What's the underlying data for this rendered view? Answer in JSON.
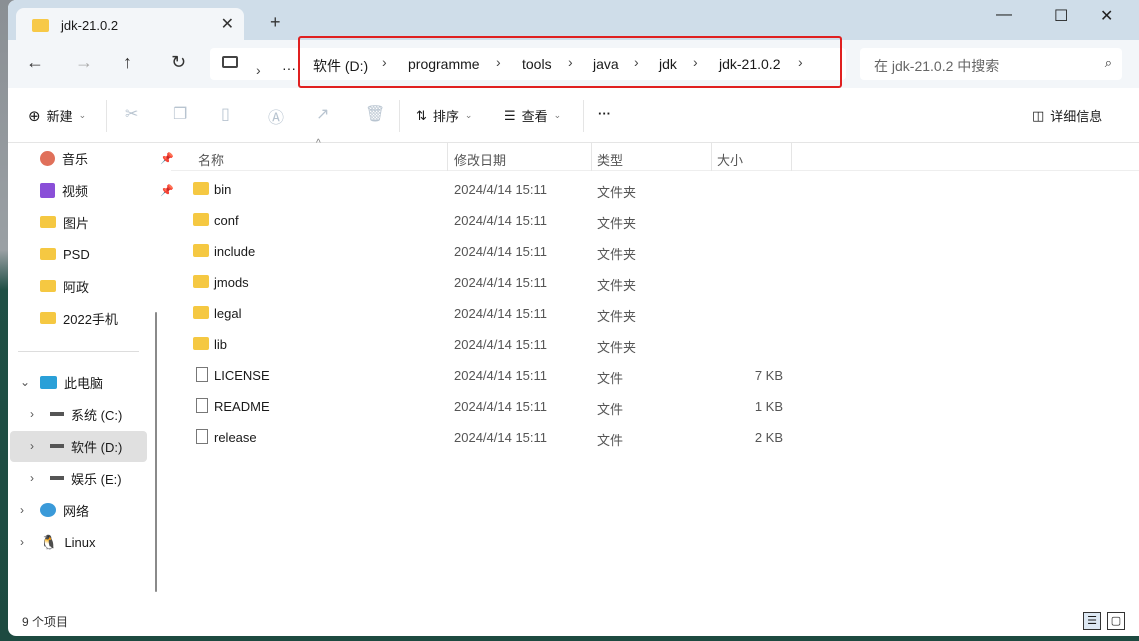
{
  "window": {
    "tab_title": "jdk-21.0.2",
    "new_tab": "+",
    "close_tab": "✕",
    "minimize": "—",
    "maximize": "☐",
    "close": "✕"
  },
  "nav": {
    "back": "←",
    "forward": "→",
    "up": "↑",
    "refresh": "↻",
    "more": "···",
    "breadcrumbs": [
      "软件 (D:)",
      "programme",
      "tools",
      "java",
      "jdk",
      "jdk-21.0.2"
    ],
    "search_placeholder": "在 jdk-21.0.2 中搜索"
  },
  "toolbar": {
    "new": "新建",
    "sort": "排序",
    "view": "查看",
    "more": "···",
    "details": "详细信息"
  },
  "sidebar": {
    "pinned": [
      {
        "label": "音乐",
        "icon": "music-icon"
      },
      {
        "label": "视频",
        "icon": "video-icon"
      },
      {
        "label": "图片",
        "icon": "folder-icon"
      },
      {
        "label": "PSD",
        "icon": "folder-icon"
      },
      {
        "label": "阿政",
        "icon": "folder-icon"
      },
      {
        "label": "2022手机",
        "icon": "folder-icon"
      }
    ],
    "this_pc": "此电脑",
    "drives": [
      {
        "label": "系统 (C:)"
      },
      {
        "label": "软件 (D:)",
        "selected": true
      },
      {
        "label": "娱乐 (E:)"
      }
    ],
    "network": "网络",
    "linux": "Linux"
  },
  "columns": {
    "name": "名称",
    "modified": "修改日期",
    "type": "类型",
    "size": "大小"
  },
  "files": [
    {
      "name": "bin",
      "date": "2024/4/14 15:11",
      "type": "文件夹",
      "size": "",
      "folder": true
    },
    {
      "name": "conf",
      "date": "2024/4/14 15:11",
      "type": "文件夹",
      "size": "",
      "folder": true
    },
    {
      "name": "include",
      "date": "2024/4/14 15:11",
      "type": "文件夹",
      "size": "",
      "folder": true
    },
    {
      "name": "jmods",
      "date": "2024/4/14 15:11",
      "type": "文件夹",
      "size": "",
      "folder": true
    },
    {
      "name": "legal",
      "date": "2024/4/14 15:11",
      "type": "文件夹",
      "size": "",
      "folder": true
    },
    {
      "name": "lib",
      "date": "2024/4/14 15:11",
      "type": "文件夹",
      "size": "",
      "folder": true
    },
    {
      "name": "LICENSE",
      "date": "2024/4/14 15:11",
      "type": "文件",
      "size": "7 KB",
      "folder": false
    },
    {
      "name": "README",
      "date": "2024/4/14 15:11",
      "type": "文件",
      "size": "1 KB",
      "folder": false
    },
    {
      "name": "release",
      "date": "2024/4/14 15:11",
      "type": "文件",
      "size": "2 KB",
      "folder": false
    }
  ],
  "status": {
    "count": "9 个项目"
  }
}
